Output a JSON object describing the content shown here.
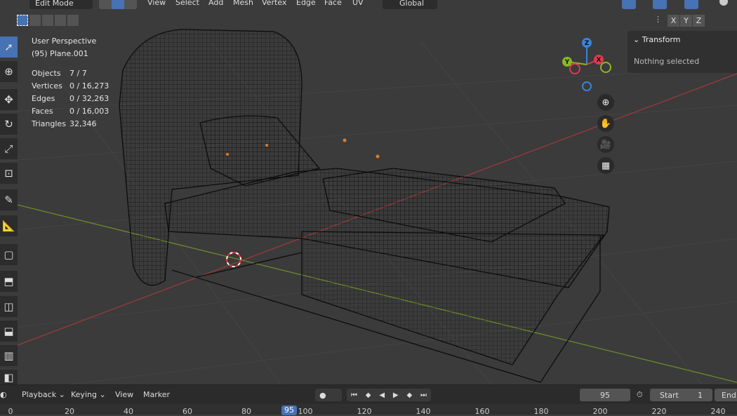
{
  "header": {
    "mode": "Edit Mode",
    "menus": [
      "View",
      "Select",
      "Add",
      "Mesh",
      "Vertex",
      "Edge",
      "Face",
      "UV"
    ],
    "orientation": "Global"
  },
  "axis_buttons": [
    "X",
    "Y",
    "Z"
  ],
  "overlay": {
    "view": "User Perspective",
    "object": "(95) Plane.001",
    "stats": [
      {
        "k": "Objects",
        "v": "7 / 7"
      },
      {
        "k": "Vertices",
        "v": "0 / 16,273"
      },
      {
        "k": "Edges",
        "v": "0 / 32,263"
      },
      {
        "k": "Faces",
        "v": "0 / 16,003"
      },
      {
        "k": "Triangles",
        "v": "32,346"
      }
    ]
  },
  "transform_panel": {
    "title": "Transform",
    "body": "Nothing selected"
  },
  "gizmo": {
    "x": "X",
    "y": "Y",
    "z": "Z",
    "colors": {
      "x": "#e0384f",
      "y": "#8ab822",
      "z": "#3b83d9"
    }
  },
  "tools": [
    "select-box",
    "cursor",
    "move",
    "rotate",
    "scale",
    "transform",
    "annotate",
    "measure",
    "add-cube",
    "extrude",
    "inset",
    "bevel",
    "loop-cut",
    "knife"
  ],
  "timeline": {
    "menus": [
      "Playback",
      "Keying",
      "View",
      "Marker"
    ],
    "current_frame": "95",
    "start_label": "Start",
    "start": "1",
    "end_label": "End",
    "ticks": [
      "0",
      "20",
      "40",
      "60",
      "80",
      "100",
      "120",
      "140",
      "160",
      "180",
      "200",
      "220",
      "240"
    ]
  }
}
